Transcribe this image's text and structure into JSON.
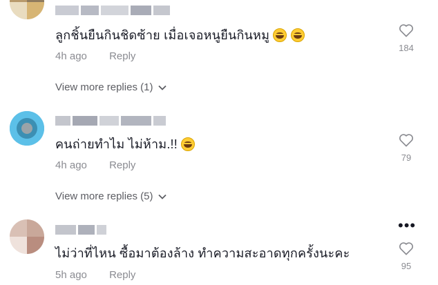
{
  "comments": [
    {
      "text": "ลูกชิ้นยืนกินชิดซ้าย เมื่อเจอหนูยืนกินหมู",
      "emoji": [
        "😂",
        "😂"
      ],
      "time": "4h ago",
      "reply_label": "Reply",
      "likes": "184",
      "more_replies": "View more replies (1)"
    },
    {
      "text": "คนถ่ายทำไม ไม่ห้าม.!!",
      "emoji": [
        "😂"
      ],
      "time": "4h ago",
      "reply_label": "Reply",
      "likes": "79",
      "more_replies": "View more replies (5)"
    },
    {
      "text": "ไม่ว่าที่ไหน ซื้อมาต้องล้าง ทำความสะอาดทุกครั้งนะคะ",
      "time": "5h ago",
      "reply_label": "Reply",
      "likes": "95"
    }
  ],
  "colors": {
    "text": "#161823",
    "muted": "#8a8b91",
    "replies": "#5c5d63"
  },
  "icons": {
    "like": "heart-outline-icon",
    "expand": "chevron-down-icon",
    "more": "more-dots-icon"
  }
}
